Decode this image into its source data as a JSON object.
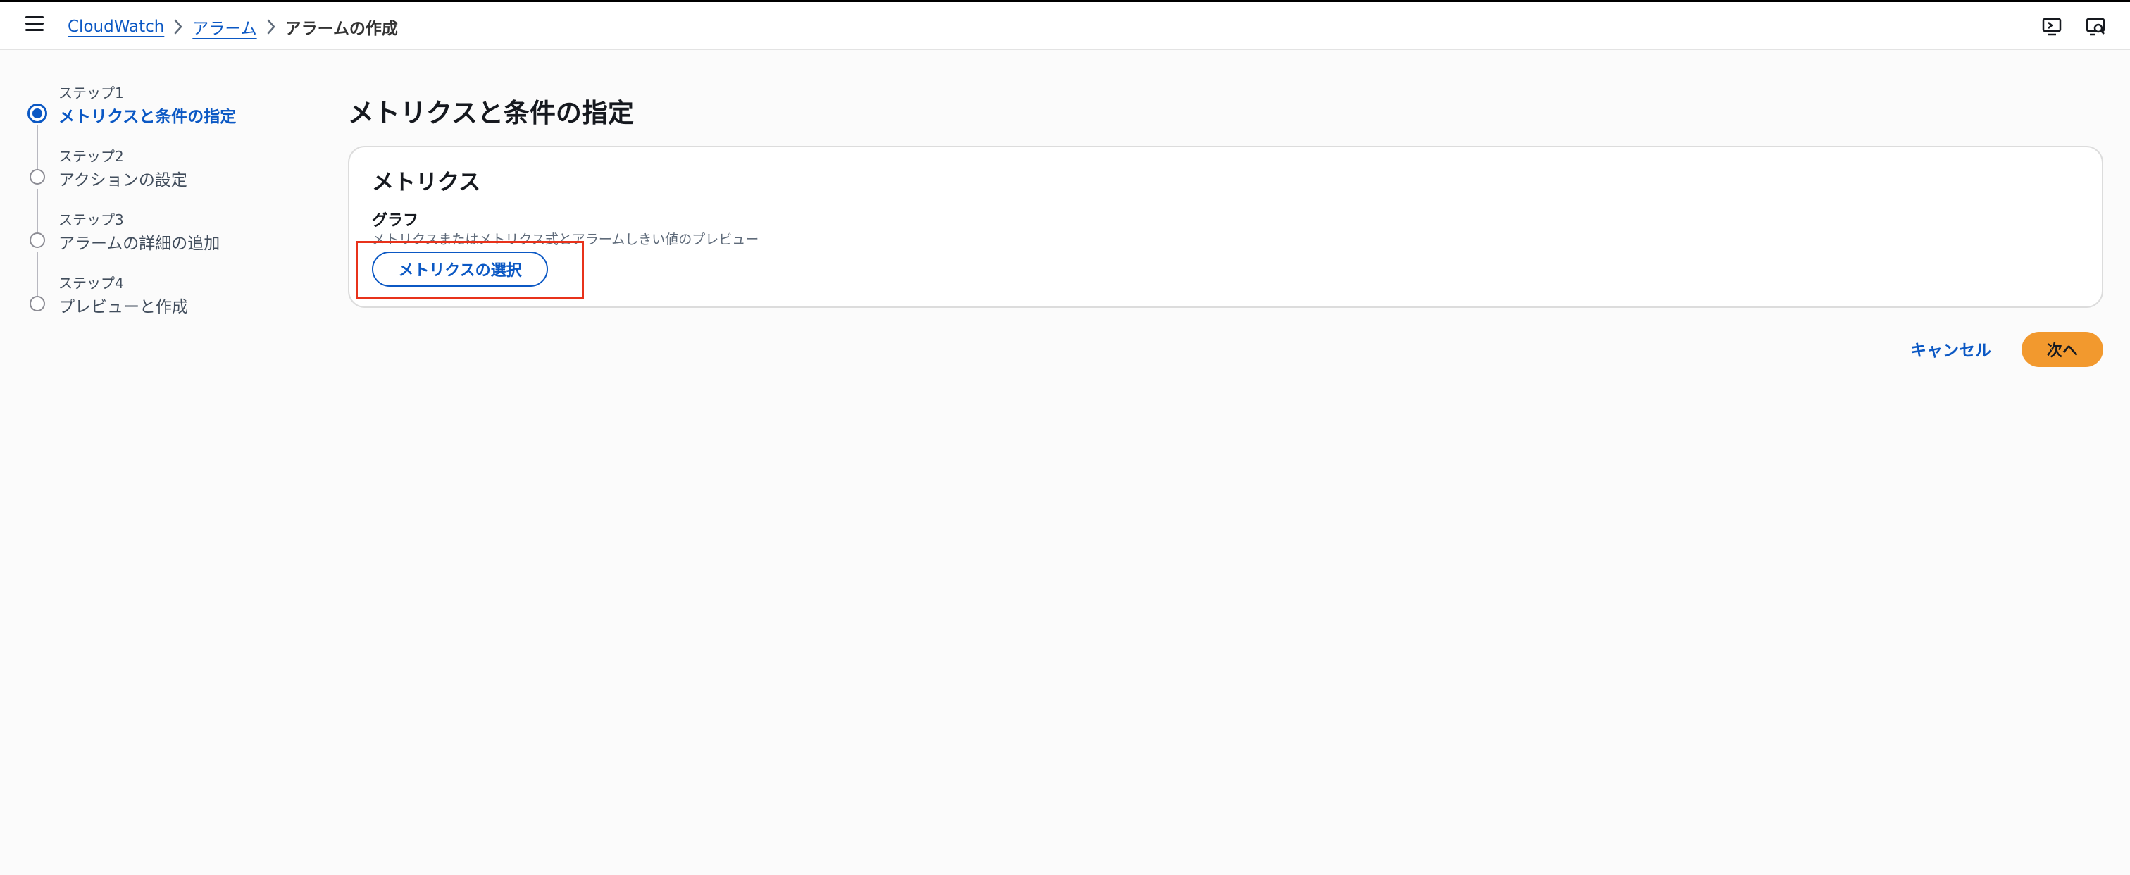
{
  "header": {
    "breadcrumb": {
      "root": "CloudWatch",
      "section": "アラーム",
      "current": "アラームの作成"
    },
    "icons": [
      "menu-icon",
      "chevron-right-icon",
      "screen-notification-icon",
      "screen-search-icon"
    ]
  },
  "steps": [
    {
      "small": "ステップ1",
      "title": "メトリクスと条件の指定",
      "active": true
    },
    {
      "small": "ステップ2",
      "title": "アクションの設定",
      "active": false
    },
    {
      "small": "ステップ3",
      "title": "アラームの詳細の追加",
      "active": false
    },
    {
      "small": "ステップ4",
      "title": "プレビューと作成",
      "active": false
    }
  ],
  "main": {
    "title": "メトリクスと条件の指定",
    "panel": {
      "title": "メトリクス",
      "graph_label": "グラフ",
      "graph_desc": "メトリクスまたはメトリクス式とアラームしきい値のプレビュー",
      "select_button": "メトリクスの選択"
    }
  },
  "actions": {
    "cancel": "キャンセル",
    "next": "次へ"
  },
  "colors": {
    "accent": "#0b58c4",
    "primary_button": "#f2992e",
    "highlight": "#e8321b"
  }
}
